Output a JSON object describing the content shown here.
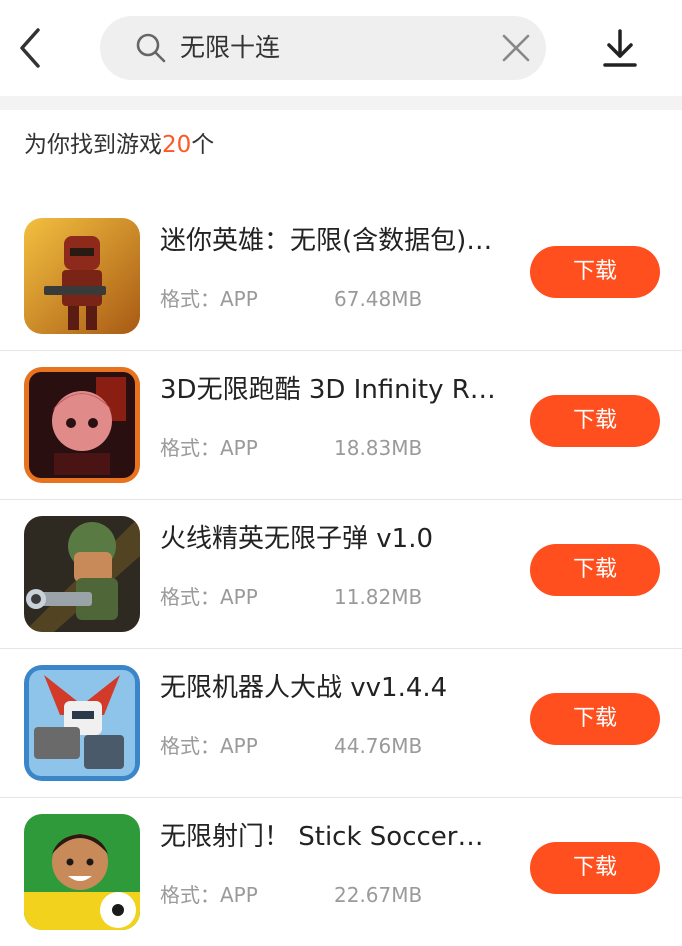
{
  "header": {
    "search_value": "无限十连",
    "icons": {
      "back": "chevron-left-icon",
      "search": "search-icon",
      "clear": "close-icon",
      "download": "download-icon"
    }
  },
  "results": {
    "prefix": "为你找到游戏",
    "count": "20",
    "suffix": "个"
  },
  "colors": {
    "accent": "#ff4f1f",
    "count_text": "#ff5722",
    "secondary_text": "#9a9a9a"
  },
  "apps": [
    {
      "name": "迷你英雄：无限(含数据包)…",
      "format": "格式：APP",
      "size": "67.48MB",
      "button": "下载"
    },
    {
      "name": "3D无限跑酷 3D Infinity R…",
      "format": "格式：APP",
      "size": "18.83MB",
      "button": "下载"
    },
    {
      "name": "火线精英无限子弹 v1.0",
      "format": "格式：APP",
      "size": "11.82MB",
      "button": "下载"
    },
    {
      "name": "无限机器人大战 vv1.4.4",
      "format": "格式：APP",
      "size": "44.76MB",
      "button": "下载"
    },
    {
      "name": "无限射门！ Stick Soccer…",
      "format": "格式：APP",
      "size": "22.67MB",
      "button": "下载"
    }
  ]
}
